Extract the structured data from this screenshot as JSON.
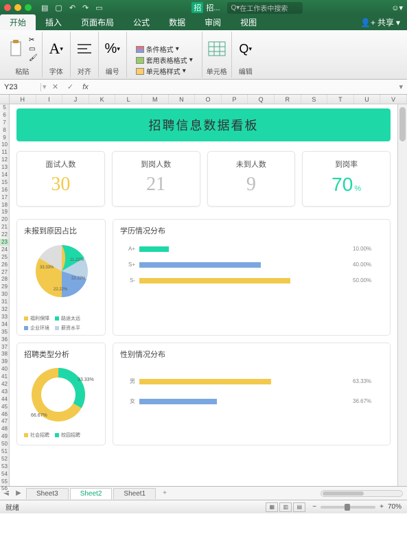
{
  "titlebar": {
    "doc_icon": "招",
    "doc_name": "招...",
    "search_placeholder": "在工作表中搜索"
  },
  "tabs": {
    "items": [
      "开始",
      "插入",
      "页面布局",
      "公式",
      "数据",
      "审阅",
      "视图"
    ],
    "active_index": 0,
    "share": "共享"
  },
  "ribbon": {
    "paste": "粘贴",
    "font": "字体",
    "align": "对齐",
    "number": "编号",
    "cond_format": "条件格式",
    "table_format": "套用表格格式",
    "cell_style": "单元格样式",
    "cells": "单元格",
    "edit": "编辑"
  },
  "formula_bar": {
    "namebox": "Y23",
    "fx": "fx"
  },
  "columns": [
    "H",
    "I",
    "J",
    "K",
    "L",
    "M",
    "N",
    "O",
    "P",
    "Q",
    "R",
    "S",
    "T",
    "U",
    "V"
  ],
  "rows_start": 5,
  "rows_end": 56,
  "selected_row": 23,
  "dashboard": {
    "banner": "招聘信息数据看板",
    "kpis": [
      {
        "label": "面试人数",
        "value": "30",
        "color": "#f2c94c"
      },
      {
        "label": "到岗人数",
        "value": "21",
        "color": "#bdbdbd"
      },
      {
        "label": "未到人数",
        "value": "9",
        "color": "#bdbdbd"
      },
      {
        "label": "到岗率",
        "value": "70",
        "suffix": "%",
        "color": "#1fd8a8"
      }
    ],
    "pie1": {
      "title": "未报到原因占比",
      "legend": [
        "福利保障",
        "路途太远",
        "企业环境",
        "薪资水平"
      ]
    },
    "bars1": {
      "title": "学历情况分布",
      "rows": [
        {
          "label": "A+",
          "value": 10.0,
          "color": "#1fd8a8",
          "width": 14
        },
        {
          "label": "S+",
          "value": 40.0,
          "color": "#7aa7e0",
          "width": 58
        },
        {
          "label": "S-",
          "value": 50.0,
          "color": "#f2c94c",
          "width": 72
        }
      ]
    },
    "pie2": {
      "title": "招聘类型分析",
      "labels": [
        "66.67%",
        "33.33%"
      ],
      "legend": [
        "社会招聘",
        "校园招聘"
      ]
    },
    "bars2": {
      "title": "性别情况分布",
      "rows": [
        {
          "label": "男",
          "value": 63.33,
          "color": "#f2c94c",
          "width": 63
        },
        {
          "label": "女",
          "value": 36.67,
          "color": "#7aa7e0",
          "width": 37
        }
      ]
    }
  },
  "chart_data": [
    {
      "type": "pie",
      "title": "未报到原因占比",
      "categories": [
        "福利保障",
        "路途太远",
        "企业环境",
        "薪资水平"
      ],
      "values": [
        33.33,
        11.11,
        22.22,
        33.33
      ]
    },
    {
      "type": "bar",
      "title": "学历情况分布",
      "categories": [
        "A+",
        "S+",
        "S-"
      ],
      "values": [
        10.0,
        40.0,
        50.0
      ],
      "xlabel": "",
      "ylabel": "",
      "ylim": [
        0,
        100
      ]
    },
    {
      "type": "pie",
      "title": "招聘类型分析",
      "categories": [
        "社会招聘",
        "校园招聘"
      ],
      "values": [
        66.67,
        33.33
      ]
    },
    {
      "type": "bar",
      "title": "性别情况分布",
      "categories": [
        "男",
        "女"
      ],
      "values": [
        63.33,
        36.67
      ],
      "xlabel": "",
      "ylabel": "",
      "ylim": [
        0,
        100
      ]
    }
  ],
  "sheet_tabs": {
    "items": [
      "Sheet3",
      "Sheet2",
      "Sheet1"
    ],
    "active_index": 1
  },
  "status": {
    "ready": "就绪",
    "zoom": "70%"
  }
}
